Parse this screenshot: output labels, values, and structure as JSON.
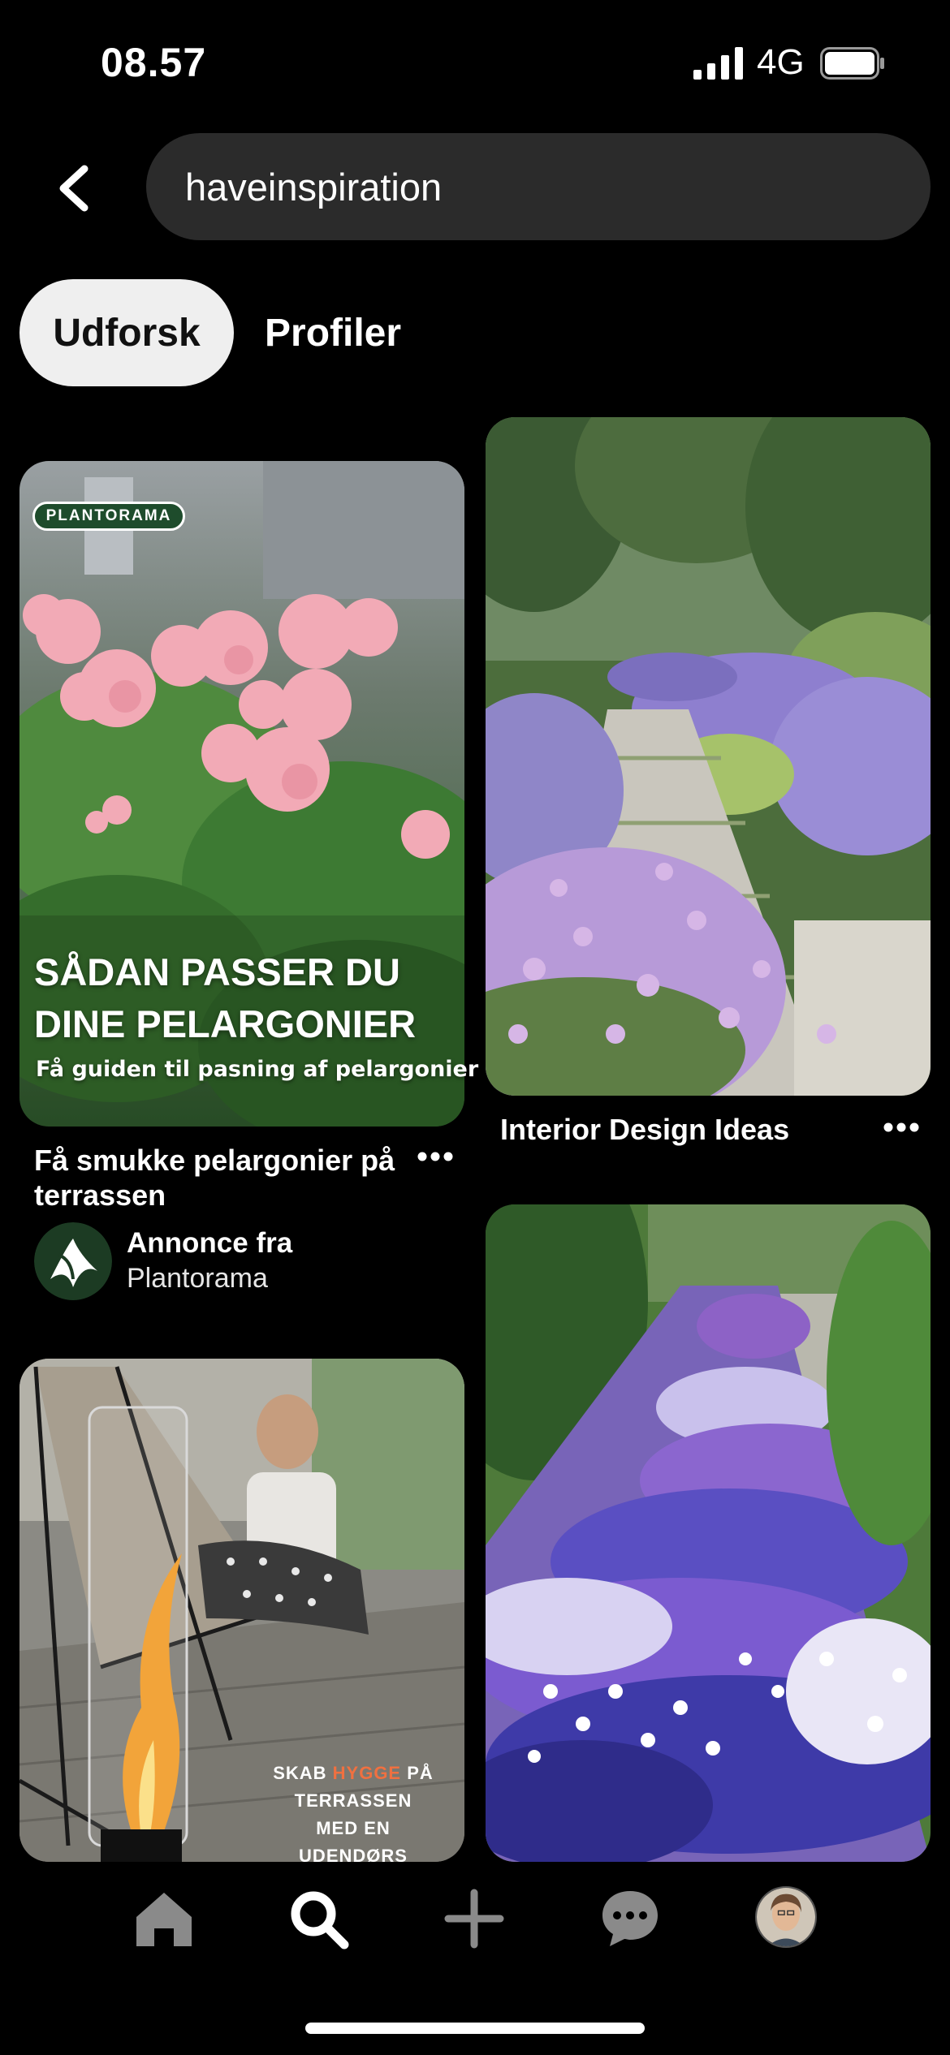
{
  "status_bar": {
    "time": "08.57",
    "network": "4G"
  },
  "search": {
    "query": "haveinspiration"
  },
  "tabs": [
    {
      "label": "Udforsk",
      "active": true
    },
    {
      "label": "Profiler",
      "active": false
    }
  ],
  "pins": [
    {
      "title": "Få smukke pelargonier på terrassen",
      "image_text": {
        "brand": "PLANTORAMA",
        "headline_1": "SÅDAN PASSER DU",
        "headline_2": "DINE PELARGONIER",
        "subline": "Få guiden til pasning af pelargonier"
      },
      "ad": {
        "line1": "Annonce fra",
        "advertiser": "Plantorama"
      }
    },
    {
      "title": "Interior Design Ideas"
    },
    {
      "image_text": {
        "line1a": "SKAB ",
        "line1b": "HYGGE",
        "line1c": " PÅ",
        "line2": "TERRASSEN",
        "line3": "MED EN",
        "line4": "UDENDØRS"
      }
    },
    {}
  ],
  "nav": {
    "items": [
      {
        "icon": "home-icon"
      },
      {
        "icon": "search-icon",
        "active": true
      },
      {
        "icon": "plus-icon"
      },
      {
        "icon": "chat-icon"
      },
      {
        "icon": "profile-avatar"
      }
    ]
  },
  "colors": {
    "background": "#000000",
    "search_bg": "#2b2b2b",
    "active_tab_bg": "#efefef",
    "brand_green": "#1e4c2c"
  }
}
